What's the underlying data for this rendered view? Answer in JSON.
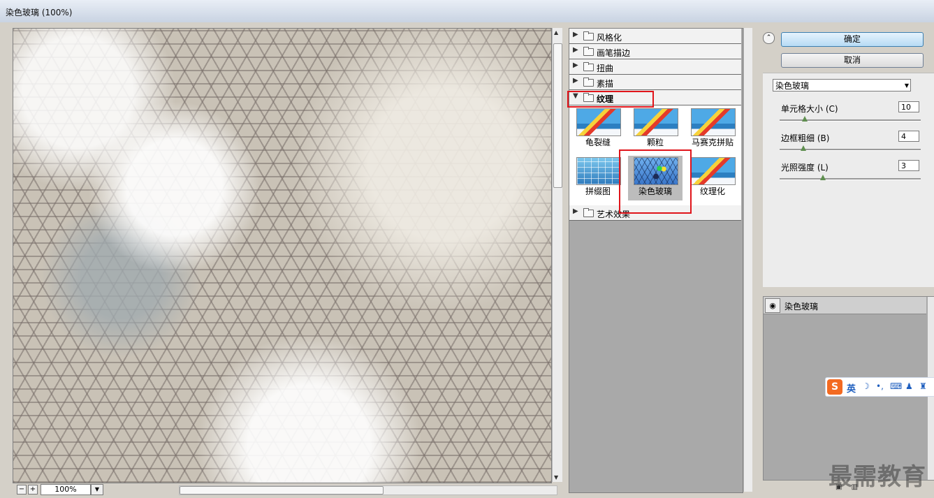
{
  "window": {
    "title": "染色玻璃 (100%)"
  },
  "preview": {
    "zoom": "100%",
    "zoom_out": "−",
    "zoom_in": "+"
  },
  "gallery": {
    "categories": [
      {
        "label": "风格化",
        "expanded": false
      },
      {
        "label": "画笔描边",
        "expanded": false
      },
      {
        "label": "扭曲",
        "expanded": false
      },
      {
        "label": "素描",
        "expanded": false
      },
      {
        "label": "纹理",
        "expanded": true
      },
      {
        "label": "艺术效果",
        "expanded": false
      }
    ],
    "filters": [
      {
        "label": "龟裂缝",
        "icon": "sailboat-thumbnail"
      },
      {
        "label": "颗粒",
        "icon": "sailboat-thumbnail"
      },
      {
        "label": "马赛克拼贴",
        "icon": "sailboat-thumbnail"
      },
      {
        "label": "拼缀图",
        "icon": "mosaic-thumbnail"
      },
      {
        "label": "染色玻璃",
        "icon": "stained-glass-thumbnail",
        "selected": true
      },
      {
        "label": "纹理化",
        "icon": "sailboat-thumbnail"
      }
    ]
  },
  "buttons": {
    "ok": "确定",
    "cancel": "取消"
  },
  "settings": {
    "filter_select": "染色玻璃",
    "params": [
      {
        "label": "单元格大小 (C)",
        "value": "10"
      },
      {
        "label": "边框粗细 (B)",
        "value": "4"
      },
      {
        "label": "光照强度 (L)",
        "value": "3"
      }
    ]
  },
  "layers": {
    "items": [
      {
        "name": "染色玻璃",
        "visible": true
      }
    ]
  },
  "ime": {
    "mode": "英"
  },
  "watermark": "最需教育",
  "colors": {
    "highlight": "#e0141a",
    "accent": "#3c7fb1"
  }
}
